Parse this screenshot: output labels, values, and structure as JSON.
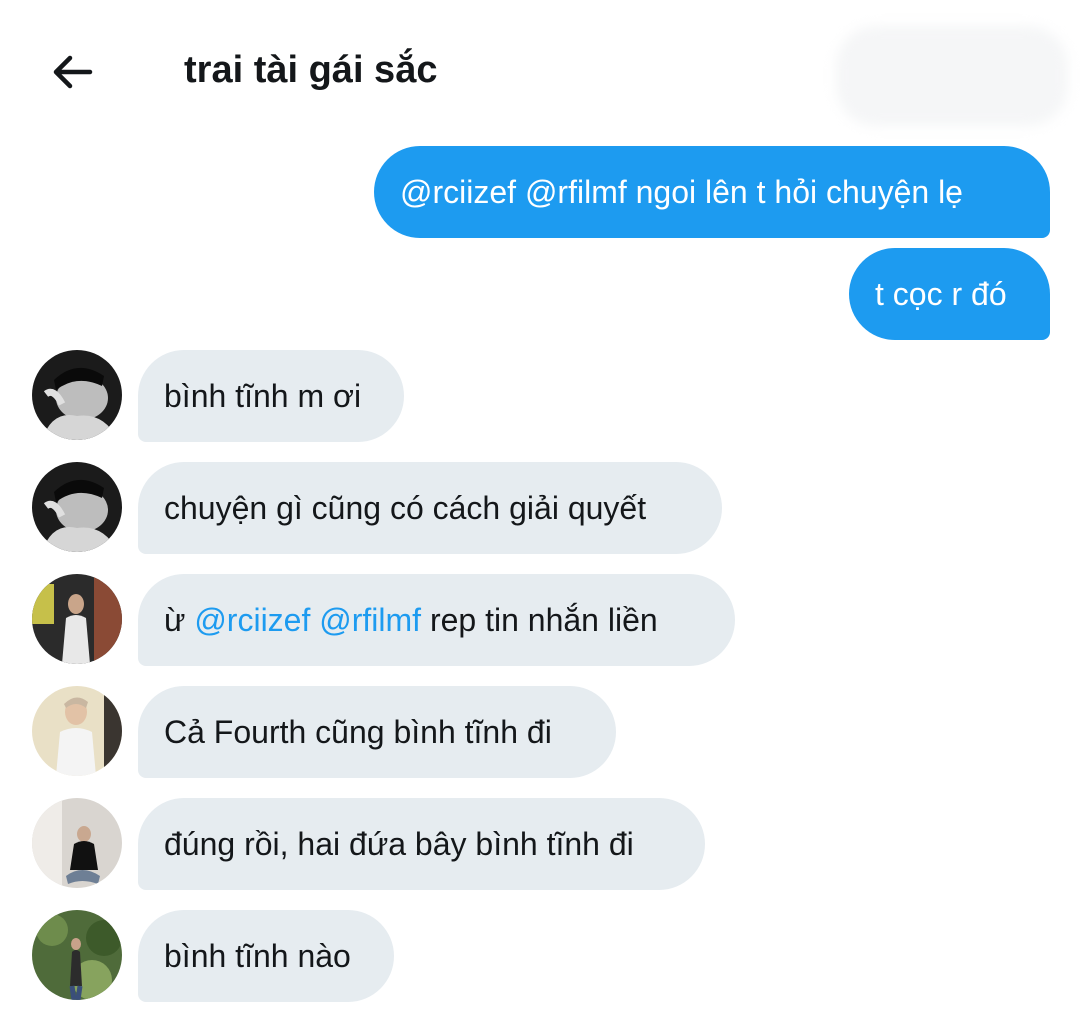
{
  "header": {
    "title": "trai tài gái sắc"
  },
  "outgoing": [
    {
      "text": "@rciizef @rfilmf ngoi lên t hỏi chuyện lẹ"
    },
    {
      "text": "t cọc r đó"
    }
  ],
  "incoming": [
    {
      "text": "bình tĩnh m ơi"
    },
    {
      "text": "chuyện gì cũng có cách giải quyết"
    },
    {
      "prefix": "ừ ",
      "mention1": "@rciizef",
      "space": " ",
      "mention2": "@rfilmf",
      "suffix": " rep tin nhắn liền"
    },
    {
      "text": "Cả Fourth cũng bình tĩnh đi"
    },
    {
      "text": "đúng rồi, hai đứa bây bình tĩnh đi"
    },
    {
      "text": "bình tĩnh nào"
    }
  ],
  "colors": {
    "outgoing_bubble": "#1d9bf0",
    "incoming_bubble": "#e6ecf0",
    "mention": "#1d9bf0"
  },
  "icons": {
    "back": "arrow-left-icon"
  }
}
